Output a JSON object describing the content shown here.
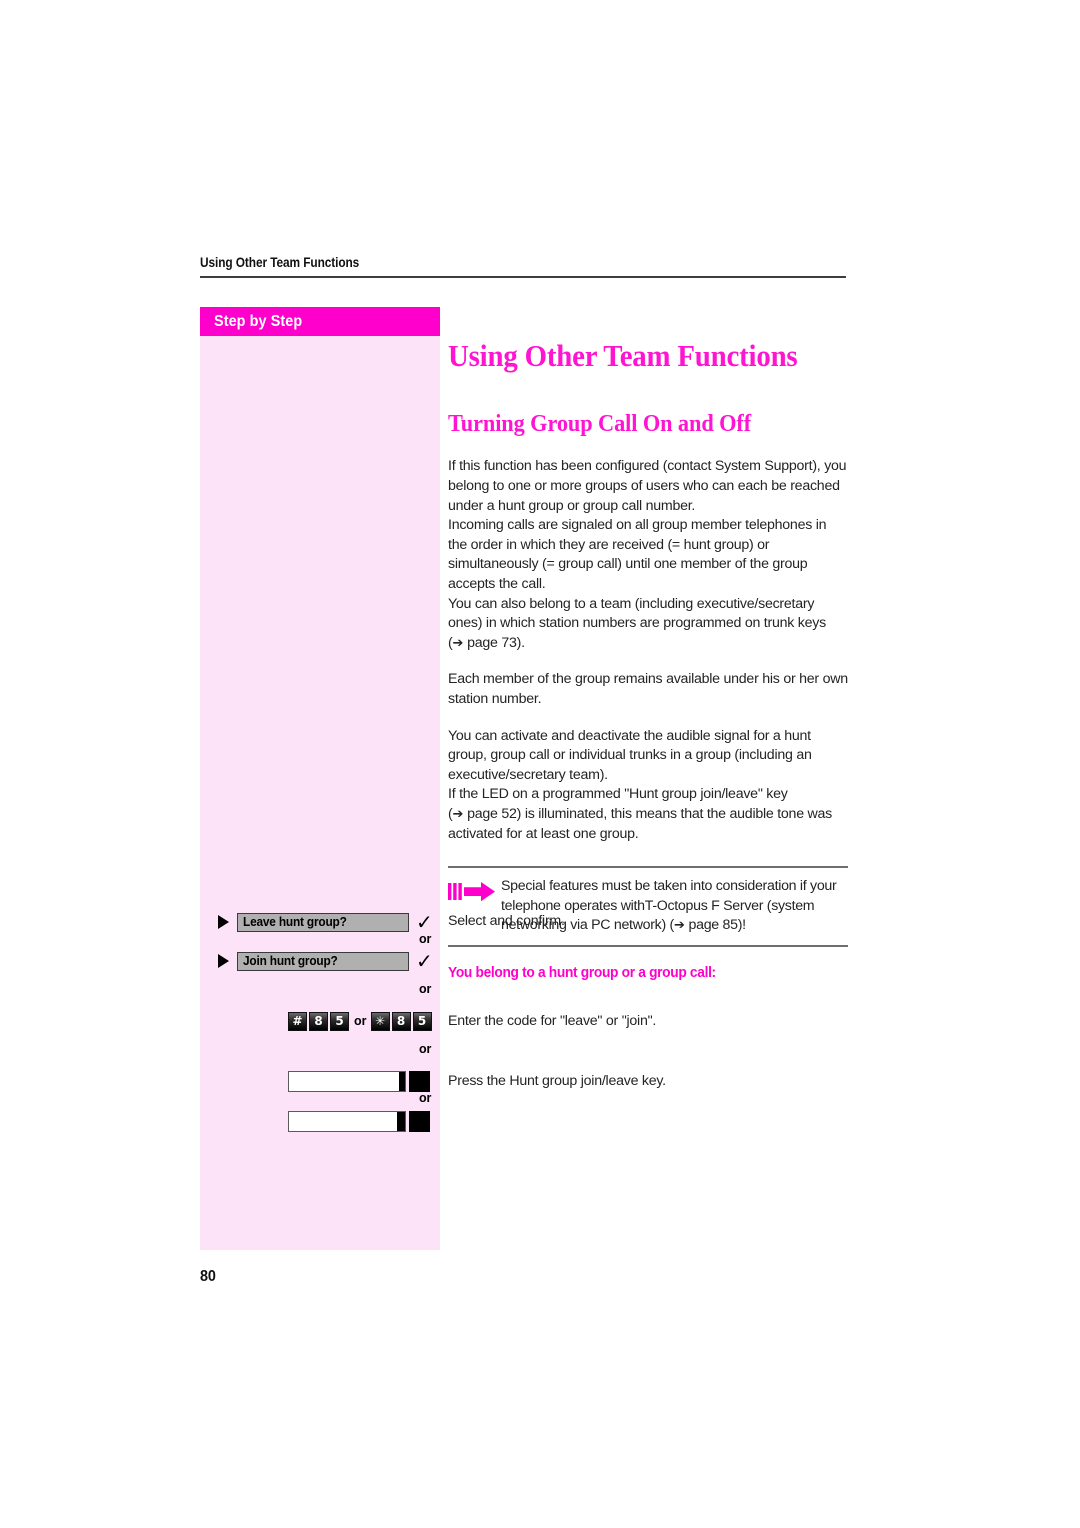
{
  "colors": {
    "magenta": "#ff00cc",
    "title_magenta": "#ff14d2",
    "sidebar_bg": "#fce3f7",
    "body_text": "#242424",
    "rule": "#3d3d3d"
  },
  "running_head": {
    "text": "Using Other Team Functions"
  },
  "sidebar": {
    "header_label": "Step by Step"
  },
  "content": {
    "doc_title": "Using Other Team Functions",
    "section_title": "Turning Group Call On and Off",
    "paragraphs": [
      "If this function has been configured (contact System Support), you belong to one or more groups of users who can each be reached under a hunt group or group call number.",
      "Incoming calls are signaled on all group member telephones in the order in which they are received (= hunt group) or simultaneously (= group call) until one member of the group accepts the call.",
      "You can also belong to a team (including executive/secretary ones) in which station numbers are programmed on trunk keys",
      "Each member of the group remains available under his or her own station number.",
      "You can activate and deactivate the audible signal for a hunt group, group call or individual trunks in a group (including an executive/secretary team).",
      "If the LED on a programmed \"Hunt group join/leave\" key",
      "is illuminated, this means that the audible tone was activated for at least one group."
    ],
    "page_ref_1": "page 73).",
    "page_ref_2": "page 52)",
    "arrow_glyph": "➔"
  },
  "note": {
    "icon_name": "magenta-arrow-icon",
    "text_part_1": "Special features must be taken into consideration if your telephone operates withT-Octopus F Server (system networking via PC network) (",
    "page_ref": "page 85)!"
  },
  "sub_head": {
    "label": "You belong to a hunt group or a group call:"
  },
  "steps": [
    {
      "type": "softkey",
      "bullet": "triangle",
      "label": "Leave hunt group?",
      "confirm": "✓",
      "description": "Select and confirm.",
      "or_after": "or"
    },
    {
      "type": "softkey",
      "bullet": "triangle",
      "label": "Join hunt group?",
      "confirm": "✓",
      "description": "",
      "or_after": "or"
    },
    {
      "type": "keypad",
      "keys_a": [
        "#",
        "8",
        "5"
      ],
      "separator": "or",
      "keys_b": [
        "✳",
        "8",
        "5"
      ],
      "description": "Enter the code for \"leave\" or \"join\".",
      "or_after": "or"
    },
    {
      "type": "function_key",
      "variant": "lit",
      "description": "Press the Hunt group join/leave key.",
      "or_after": "or"
    },
    {
      "type": "function_key",
      "variant": "unlit",
      "description": "",
      "or_after": ""
    }
  ],
  "folio": {
    "page_number": "80"
  }
}
